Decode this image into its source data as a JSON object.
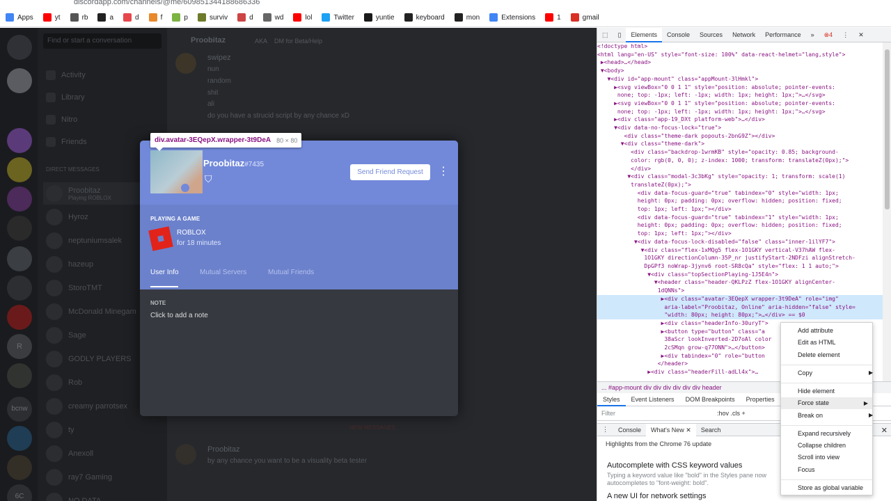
{
  "browser": {
    "url": "discordapp.com/channels/@me/609851344188686336",
    "bookmarks": [
      {
        "label": "Apps",
        "icon": "apps-grid-icon",
        "color": "#4285f4"
      },
      {
        "label": "yt",
        "icon": "youtube-icon",
        "color": "#ff0000"
      },
      {
        "label": "rb",
        "icon": "roblox-icon",
        "color": "#555555"
      },
      {
        "label": "a",
        "icon": "amazon-icon",
        "color": "#222222"
      },
      {
        "label": "d",
        "icon": "discord-icon",
        "color": "#e5474b"
      },
      {
        "label": "f",
        "icon": "f-icon",
        "color": "#e8892c"
      },
      {
        "label": "p",
        "icon": "leaf-icon",
        "color": "#7cb342"
      },
      {
        "label": "surviv",
        "icon": "surviv-icon",
        "color": "#6d7b2b"
      },
      {
        "label": "d",
        "icon": "d-icon",
        "color": "#cc4444"
      },
      {
        "label": "wd",
        "icon": "globe-icon",
        "color": "#666666"
      },
      {
        "label": "lol",
        "icon": "youtube-icon",
        "color": "#ff0000"
      },
      {
        "label": "Twitter",
        "icon": "twitter-icon",
        "color": "#1da1f2"
      },
      {
        "label": "yuntie",
        "icon": "yuntie-icon",
        "color": "#1a1a1a"
      },
      {
        "label": "keyboard",
        "icon": "amazon-icon",
        "color": "#222222"
      },
      {
        "label": "mon",
        "icon": "amazon-icon",
        "color": "#222222"
      },
      {
        "label": "Extensions",
        "icon": "puzzle-icon",
        "color": "#4285f4"
      },
      {
        "label": "1",
        "icon": "youtube-icon",
        "color": "#ff0000"
      },
      {
        "label": "gmail",
        "icon": "gmail-icon",
        "color": "#d93025"
      }
    ]
  },
  "discord": {
    "search_placeholder": "Find or start a conversation",
    "nav": [
      "Activity",
      "Library",
      "Nitro",
      "Friends"
    ],
    "dm_header": "DIRECT MESSAGES",
    "dms": [
      {
        "name": "Proobitaz",
        "status": "Playing ROBLOX"
      },
      {
        "name": "Hyroz",
        "status": ""
      },
      {
        "name": "neptuniumsalek",
        "status": ""
      },
      {
        "name": "hazeup",
        "status": ""
      },
      {
        "name": "StoroTMT",
        "status": ""
      },
      {
        "name": "McDonald Minegam",
        "status": ""
      },
      {
        "name": "Sage",
        "status": ""
      },
      {
        "name": "GODLY PLAYERS",
        "status": ""
      },
      {
        "name": "Rob",
        "status": ""
      },
      {
        "name": "creamy parrotsex",
        "status": ""
      },
      {
        "name": "ty",
        "status": ""
      },
      {
        "name": "Anexoll",
        "status": ""
      },
      {
        "name": "ray7 Gaming",
        "status": ""
      },
      {
        "name": "NO DATA",
        "status": ""
      }
    ],
    "chat_header": "Proobitaz",
    "chat_sub": "AKA",
    "chat_sub2": "DM for Beta/Help",
    "chat_author": "swipez",
    "chat_lines": [
      "nun",
      "random",
      "shit",
      "ali",
      "do you have a strucid script by any chance xD"
    ],
    "chat_author2": "Proobitaz",
    "chat_line2": "by any chance you want to be a  visuality beta tester",
    "unread_label": "NEW MESSAGES",
    "guild_letters": [
      "R",
      "bcnw",
      "6C"
    ]
  },
  "tooltip": {
    "selector": "div.avatar-3EQepX.wrapper-3t9DeA",
    "dims": "80 × 80"
  },
  "profile": {
    "username": "Proobitaz",
    "discriminator": "#7435",
    "friend_button": "Send Friend Request",
    "more_icon": "⋮",
    "playing_label": "PLAYING A GAME",
    "game_name": "ROBLOX",
    "game_time": "for 18 minutes",
    "tabs": [
      "User Info",
      "Mutual Servers",
      "Mutual Friends"
    ],
    "active_tab": "User Info",
    "note_label": "NOTE",
    "note_value": "Click to add a note",
    "header_color": "#7289da"
  },
  "devtools": {
    "tabs": [
      "Elements",
      "Console",
      "Sources",
      "Network",
      "Performance",
      "»"
    ],
    "active_tab": "Elements",
    "error_count": "4",
    "dom_lines": [
      "<!doctype html>",
      "<html lang=\"en-US\" style=\"font-size: 100%\" data-react-helmet=\"lang,style\">",
      " ▶<head>…</head>",
      " ▼<body>",
      "   ▼<div id=\"app-mount\" class=\"appMount-3lHmkl\">",
      "     ▶<svg viewBox=\"0 0 1 1\" style=\"position: absolute; pointer-events:",
      "      none; top: -1px; left: -1px; width: 1px; height: 1px;\">…</svg>",
      "     ▶<svg viewBox=\"0 0 1 1\" style=\"position: absolute; pointer-events:",
      "      none; top: -1px; left: -1px; width: 1px; height: 1px;\">…</svg>",
      "     ▶<div class=\"app-19_DXt platform-web\">…</div>",
      "     ▼<div data-no-focus-lock=\"true\">",
      "        <div class=\"theme-dark popouts-2bnG9Z\"></div>",
      "       ▼<div class=\"theme-dark\">",
      "          <div class=\"backdrop-1wrmKB\" style=\"opacity: 0.85; background-",
      "          color: rgb(0, 0, 0); z-index: 1000; transform: translateZ(0px);\">",
      "          </div>",
      "         ▼<div class=\"modal-3c3bKg\" style=\"opacity: 1; transform: scale(1)",
      "          translateZ(0px);\">",
      "            <div data-focus-guard=\"true\" tabindex=\"0\" style=\"width: 1px;",
      "            height: 0px; padding: 0px; overflow: hidden; position: fixed;",
      "            top: 1px; left: 1px;\"></div>",
      "            <div data-focus-guard=\"true\" tabindex=\"1\" style=\"width: 1px;",
      "            height: 0px; padding: 0px; overflow: hidden; position: fixed;",
      "            top: 1px; left: 1px;\"></div>",
      "           ▼<div data-focus-lock-disabled=\"false\" class=\"inner-1ilYF7\">",
      "             ▼<div class=\"flex-1xMQg5 flex-1O1GKY vertical-V37hAW flex-",
      "              1O1GKY directionColumn-35P_nr justifyStart-2NDFzi alignStretch-",
      "              DpGPf3 noWrap-3jynv6 root-SR8cQa\" style=\"flex: 1 1 auto;\">",
      "               ▼<div class=\"topSectionPlaying-1J5E4n\">",
      "                 ▼<header class=\"header-QKLPzZ flex-1O1GKY alignCenter-",
      "                  1dQNNs\">",
      "                   ▶<div class=\"avatar-3EQepX wrapper-3t9DeA\" role=\"img\"",
      "                    aria-label=\"Proobitaz, Online\" aria-hidden=\"false\" style=",
      "                    \"width: 80px; height: 80px;\">…</div> == $0",
      "                   ▶<div class=\"headerInfo-30uryT\">",
      "                   ▶<button type=\"button\" class=\"a",
      "                    38aScr lookInverted-2D7oAl color",
      "                    2cSMqn grow-q77ONN\">…</button>",
      "                   ▶<div tabindex=\"0\" role=\"button",
      "                  </header>",
      "               ▶<div class=\"headerFill-adLl4x\">…"
    ],
    "highlight_lines": [
      31,
      32,
      33
    ],
    "crumbs": "...   #app-mount   div   div   div   div   div   div   header",
    "subtabs": [
      "Styles",
      "Event Listeners",
      "DOM Breakpoints",
      "Properties"
    ],
    "filter_placeholder": "Filter",
    "filter_ops": ":hov  .cls  +",
    "drawer_tabs": [
      "Console",
      "What's New",
      "Search"
    ],
    "drawer_active": "What's New",
    "whats_new_header": "Highlights from the Chrome 76 update",
    "wn1_title": "Autocomplete with CSS keyword values",
    "wn1_desc": "Typing a keyword value like \"bold\" in the Styles pane now autocompletes to \"font-weight: bold\".",
    "wn2_title": "A new UI for network settings"
  },
  "context_menu": {
    "items": [
      {
        "label": "Add attribute",
        "arrow": false
      },
      {
        "label": "Edit as HTML",
        "arrow": false
      },
      {
        "label": "Delete element",
        "arrow": false
      },
      {
        "label": "Copy",
        "arrow": true
      },
      {
        "label": "Hide element",
        "arrow": false
      },
      {
        "label": "Force state",
        "arrow": true
      },
      {
        "label": "Break on",
        "arrow": true
      },
      {
        "label": "Expand recursively",
        "arrow": false
      },
      {
        "label": "Collapse children",
        "arrow": false
      },
      {
        "label": "Scroll into view",
        "arrow": false
      },
      {
        "label": "Focus",
        "arrow": false
      },
      {
        "label": "Store as global variable",
        "arrow": false
      }
    ],
    "hovered": "Force state"
  }
}
